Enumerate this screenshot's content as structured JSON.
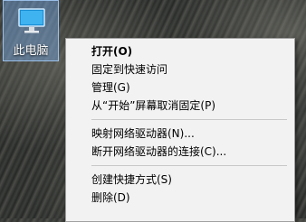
{
  "desktop": {
    "icon_label": "此电脑",
    "icon_name": "this-pc-icon"
  },
  "context_menu": {
    "groups": [
      [
        {
          "label": "打开(O)",
          "bold": true
        },
        {
          "label": "固定到快速访问"
        },
        {
          "label": "管理(G)"
        },
        {
          "label": "从“开始”屏幕取消固定(P)"
        }
      ],
      [
        {
          "label": "映射网络驱动器(N)..."
        },
        {
          "label": "断开网络驱动器的连接(C)..."
        }
      ],
      [
        {
          "label": "创建快捷方式(S)"
        },
        {
          "label": "删除(D)"
        }
      ]
    ]
  },
  "colors": {
    "menu_background": "#f2f2f2",
    "selection_highlight": "#78aae6"
  }
}
